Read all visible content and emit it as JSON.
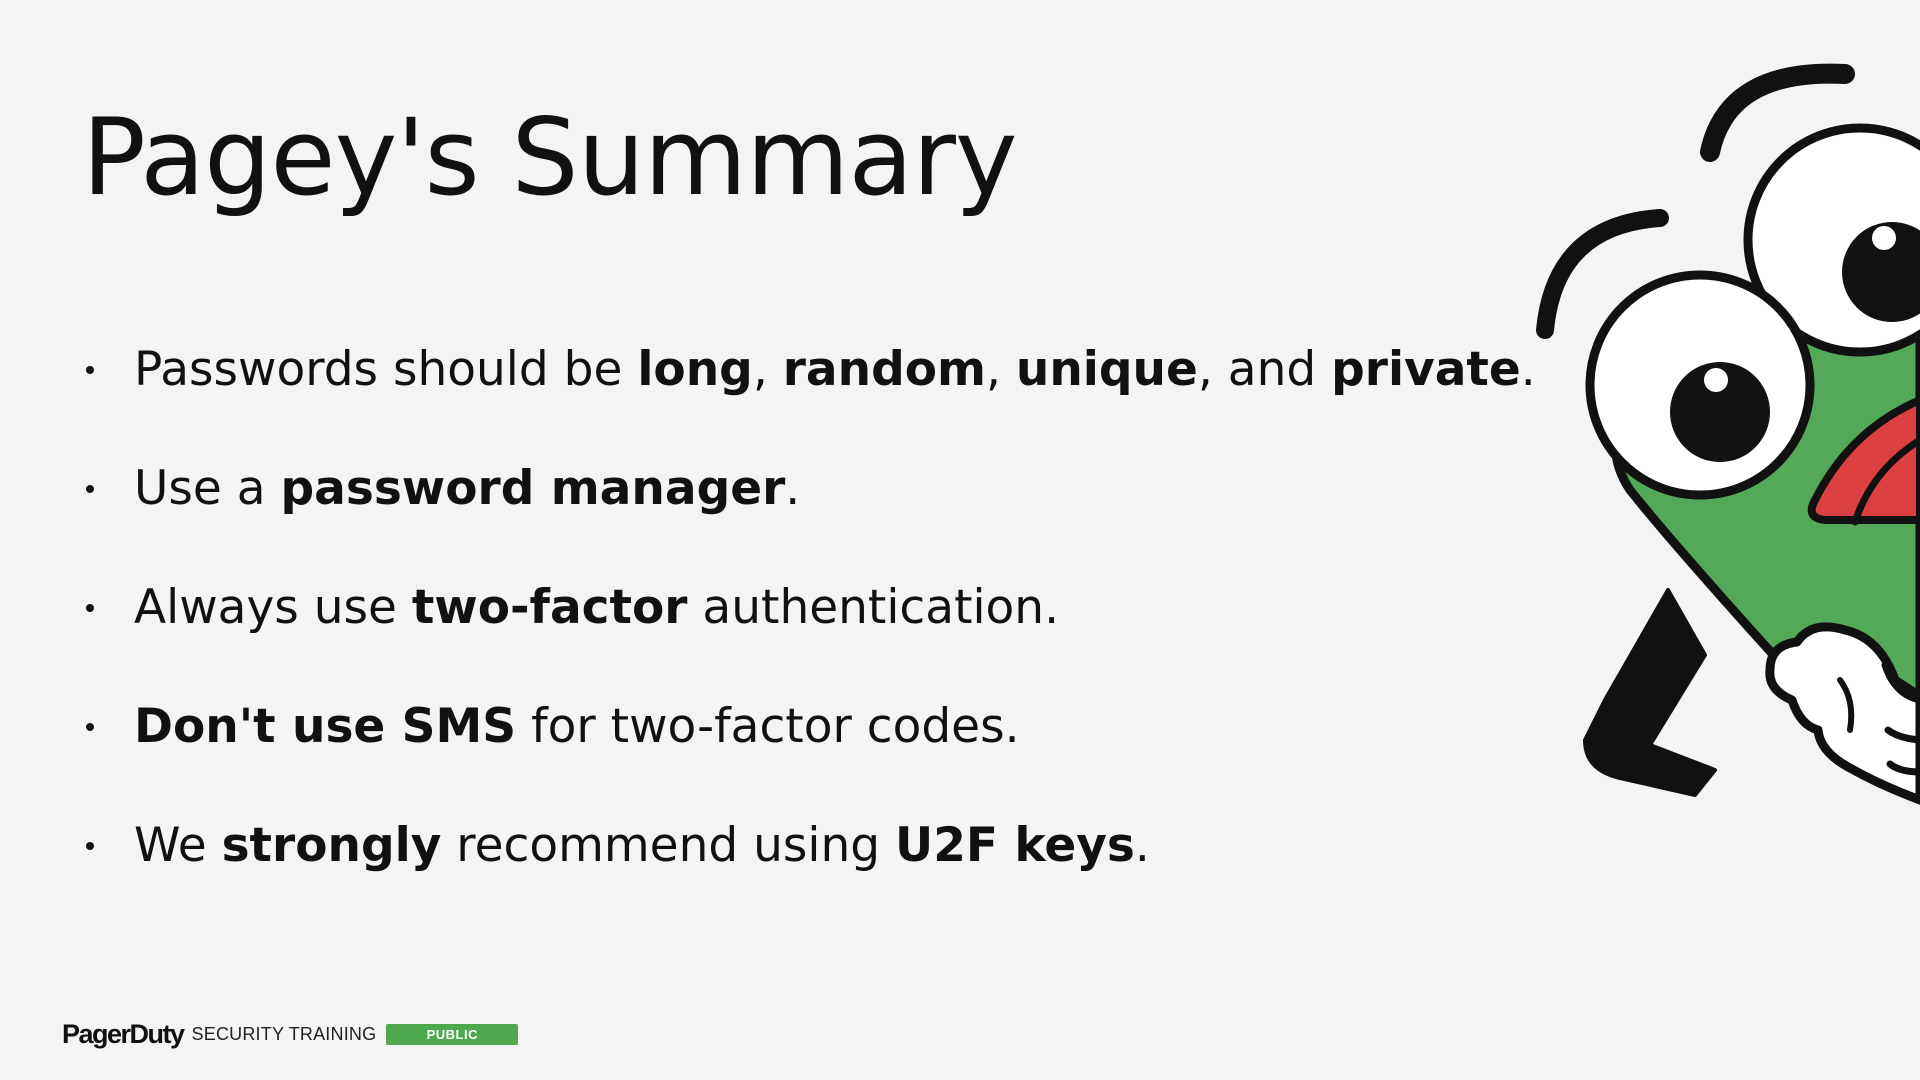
{
  "slide": {
    "title": "Pagey's Summary",
    "bullets": [
      {
        "parts": [
          {
            "text": "Passwords should be ",
            "bold": false
          },
          {
            "text": "long",
            "bold": true
          },
          {
            "text": ", ",
            "bold": false
          },
          {
            "text": "random",
            "bold": true
          },
          {
            "text": ", ",
            "bold": false
          },
          {
            "text": "unique",
            "bold": true
          },
          {
            "text": ", and ",
            "bold": false
          },
          {
            "text": "private",
            "bold": true
          },
          {
            "text": ".",
            "bold": false
          }
        ]
      },
      {
        "parts": [
          {
            "text": "Use a ",
            "bold": false
          },
          {
            "text": "password manager",
            "bold": true
          },
          {
            "text": ".",
            "bold": false
          }
        ]
      },
      {
        "parts": [
          {
            "text": "Always use ",
            "bold": false
          },
          {
            "text": "two-factor",
            "bold": true
          },
          {
            "text": " authentication.",
            "bold": false
          }
        ]
      },
      {
        "parts": [
          {
            "text": "Don't use SMS",
            "bold": true
          },
          {
            "text": " for two-factor codes.",
            "bold": false
          }
        ]
      },
      {
        "parts": [
          {
            "text": "We ",
            "bold": false
          },
          {
            "text": "strongly",
            "bold": true
          },
          {
            "text": " recommend using ",
            "bold": false
          },
          {
            "text": "U2F keys",
            "bold": true
          },
          {
            "text": ".",
            "bold": false
          }
        ]
      }
    ]
  },
  "footer": {
    "brand": "PagerDuty",
    "subtitle": "SECURITY TRAINING",
    "badge": "PUBLIC"
  },
  "colors": {
    "background": "#f4f4f4",
    "text": "#111111",
    "badge": "#4fa74f",
    "mascot_green": "#53a957",
    "mascot_tongue": "#dc4040"
  },
  "icons": {
    "mascot": "pagey-mascot-icon"
  }
}
